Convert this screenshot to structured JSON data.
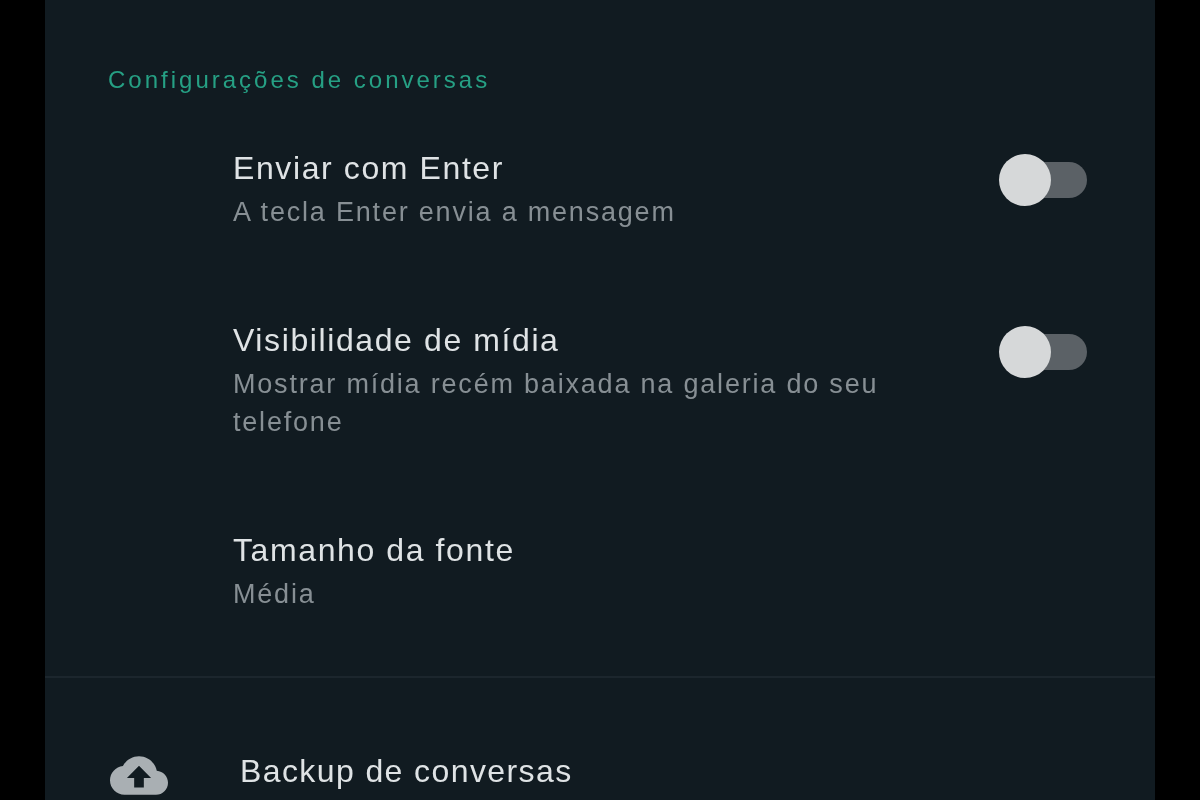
{
  "section_title": "Configurações de conversas",
  "settings": [
    {
      "kind": "toggle",
      "title": "Enviar com Enter",
      "subtitle": "A tecla Enter envia a mensagem",
      "on": false
    },
    {
      "kind": "toggle",
      "title": "Visibilidade de mídia",
      "subtitle": "Mostrar mídia recém baixada na galeria do seu telefone",
      "on": false
    },
    {
      "kind": "value",
      "title": "Tamanho da fonte",
      "subtitle": "Média"
    }
  ],
  "backup": {
    "title": "Backup de conversas"
  }
}
